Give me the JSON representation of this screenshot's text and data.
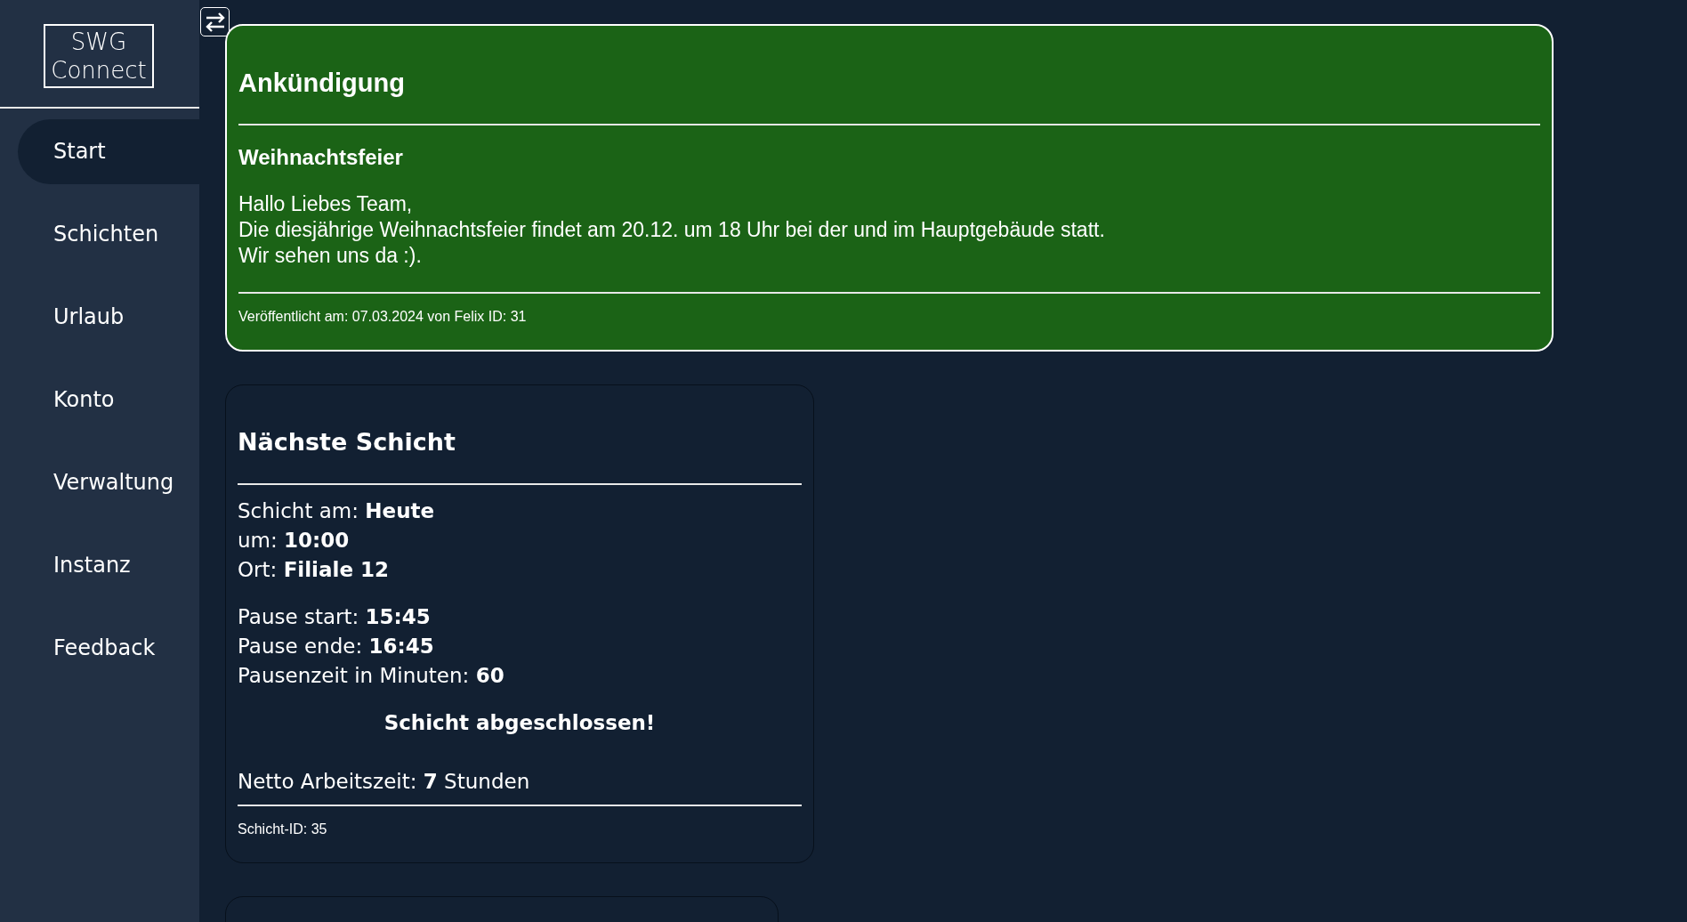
{
  "sidebar": {
    "logo": [
      "SWG",
      "Connect"
    ],
    "items": [
      {
        "label": "Start",
        "selected": true
      },
      {
        "label": "Schichten",
        "selected": false
      },
      {
        "label": "Urlaub",
        "selected": false
      },
      {
        "label": "Konto",
        "selected": false
      },
      {
        "label": "Verwaltung",
        "selected": false
      },
      {
        "label": "Instanz",
        "selected": false
      },
      {
        "label": "Feedback",
        "selected": false
      }
    ]
  },
  "announcement": {
    "title": "Ankündigung",
    "subtitle": "Weihnachtsfeier",
    "body": [
      "Hallo Liebes Team,",
      "Die diesjährige Weihnachtsfeier findet am 20.12. um 18 Uhr bei der und im Hauptgebäude statt.",
      "Wir sehen uns da :)."
    ],
    "footer": "Veröffentlicht am: 07.03.2024 von Felix ID: 31"
  },
  "next_shift": {
    "title": "Nächste Schicht",
    "groups": [
      [
        "Schicht am: **Heute**",
        "um: **10:00**",
        "Ort: **Filiale 12**"
      ],
      [
        "Pause start: **15:45**",
        "Pause ende: **16:45**",
        "Pausenzeit in Minuten: **60**"
      ]
    ],
    "status": "Schicht abgeschlossen!",
    "net_time": "Netto Arbeitszeit: **7** Stunden",
    "footer": "Schicht-ID: 35"
  }
}
